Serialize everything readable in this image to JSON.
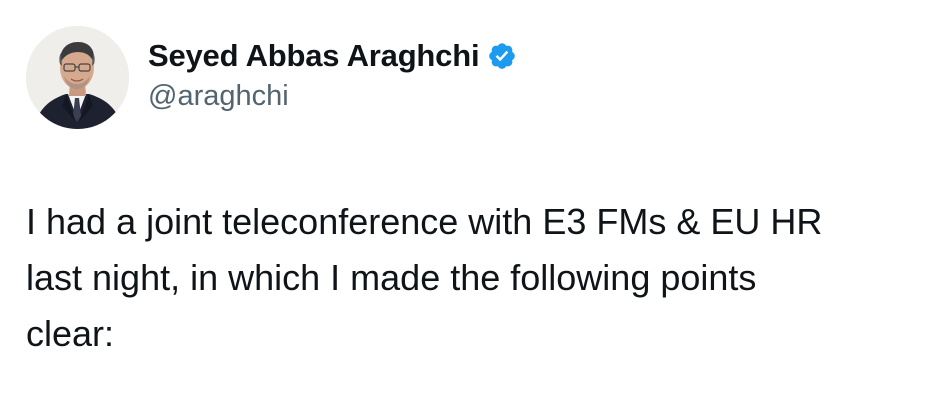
{
  "author": {
    "display_name": "Seyed Abbas Araghchi",
    "handle": "@araghchi",
    "verified_icon": "verified-badge-icon",
    "verified_color": "#1d9bf0",
    "avatar": "profile-photo"
  },
  "tweet": {
    "lines": [
      "I had a joint teleconference with E3 FMs & EU HR",
      "last night, in which I made the following points",
      "clear:"
    ]
  }
}
